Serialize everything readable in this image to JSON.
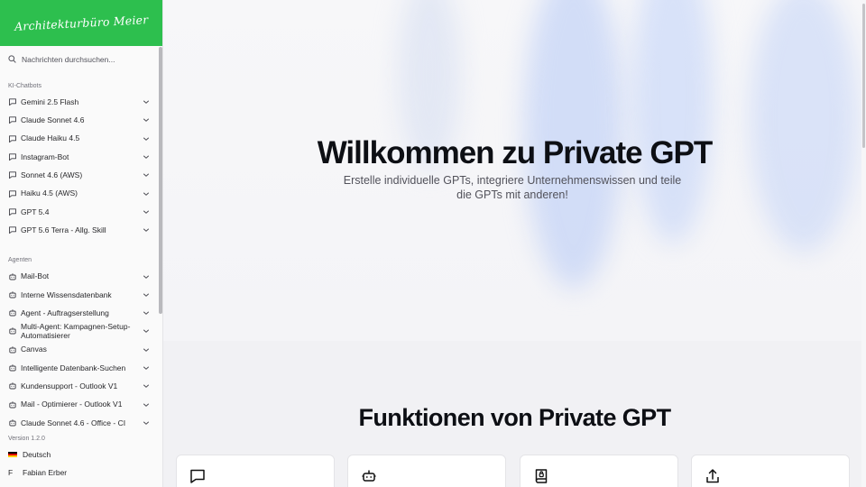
{
  "brand": {
    "logo_text": "Architekturbüro Meier",
    "accent": "#2dbf4e"
  },
  "search": {
    "placeholder": "Nachrichten durchsuchen..."
  },
  "sections": {
    "chatbots_title": "KI-Chatbots",
    "agents_title": "Agenten"
  },
  "chatbots": [
    {
      "label": "Gemini 2.5 Flash"
    },
    {
      "label": "Claude Sonnet 4.6"
    },
    {
      "label": "Claude Haiku 4.5"
    },
    {
      "label": "Instagram-Bot"
    },
    {
      "label": "Sonnet 4.6 (AWS)"
    },
    {
      "label": "Haiku 4.5 (AWS)"
    },
    {
      "label": "GPT 5.4"
    },
    {
      "label": "GPT 5.6 Terra - Allg. Skill"
    }
  ],
  "agents": [
    {
      "label": "Mail-Bot"
    },
    {
      "label": "Interne Wissensdatenbank"
    },
    {
      "label": "Agent - Auftragserstellung"
    },
    {
      "label": "Multi-Agent: Kampagnen-Setup-Automatisierer"
    },
    {
      "label": "Canvas"
    },
    {
      "label": "Intelligente Datenbank-Suchen"
    },
    {
      "label": "Kundensupport - Outlook V1"
    },
    {
      "label": "Mail - Optimierer - Outlook V1"
    },
    {
      "label": "Claude Sonnet 4.6 - Office - CI"
    }
  ],
  "footer": {
    "version": "Version 1.2.0",
    "language": "Deutsch",
    "user_initial": "F",
    "user_name": "Fabian Erber"
  },
  "hero": {
    "title": "Willkommen zu Private GPT",
    "subtitle": "Erstelle individuelle GPTs, integriere Unternehmenswissen und teile die GPTs mit anderen!"
  },
  "features": {
    "title": "Funktionen von Private GPT",
    "cards": [
      {
        "icon": "chat-bubble-icon"
      },
      {
        "icon": "robot-icon"
      },
      {
        "icon": "knowledge-book-icon"
      },
      {
        "icon": "share-icon"
      }
    ]
  }
}
